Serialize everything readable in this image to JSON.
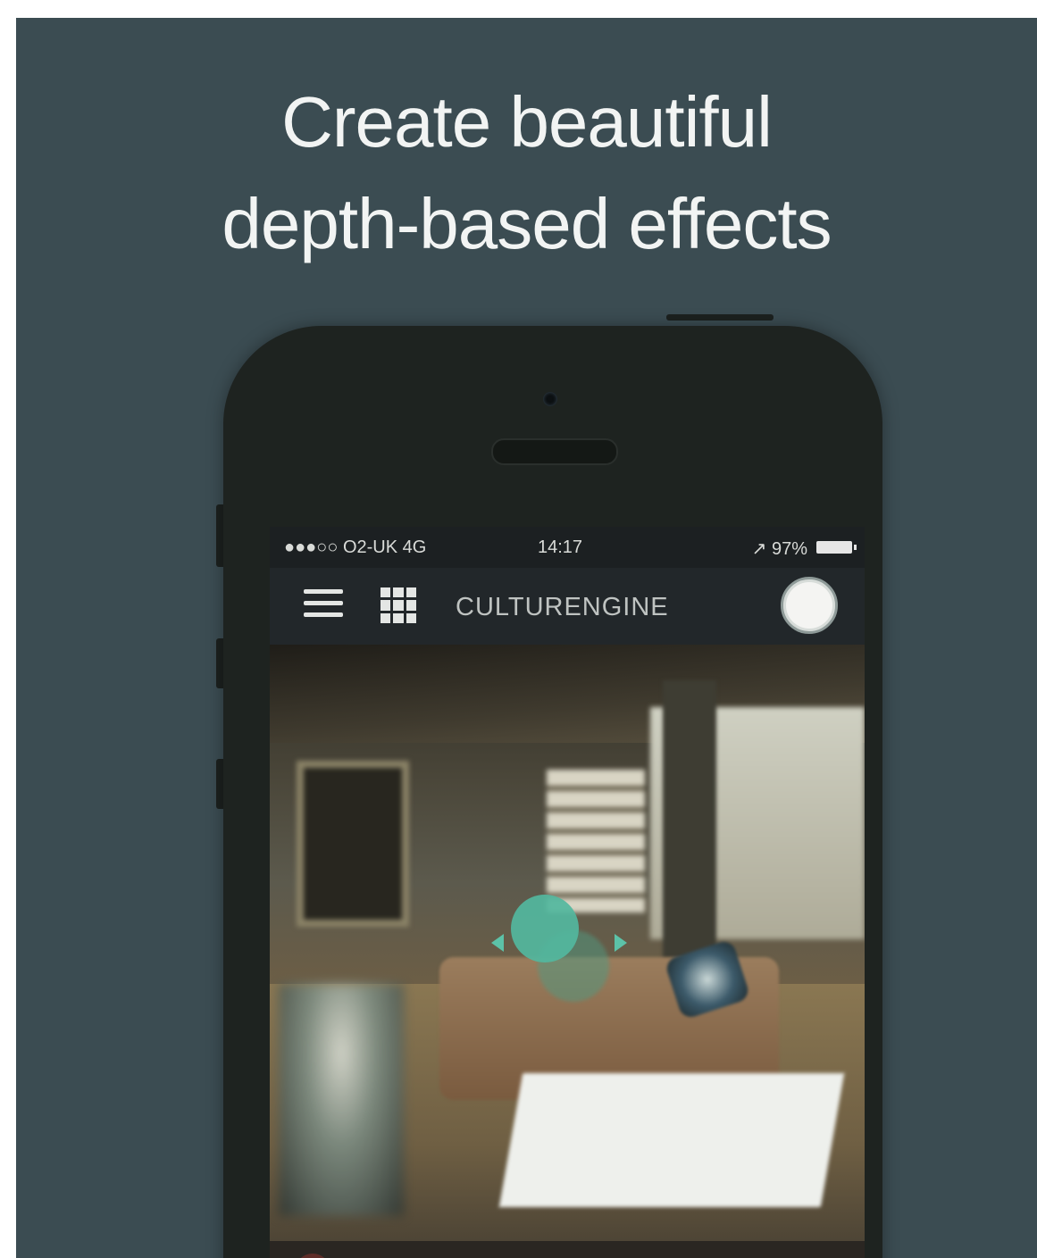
{
  "headline": {
    "line1": "Create beautiful",
    "line2": "depth-based effects"
  },
  "status_bar": {
    "carrier": "●●●○○ O2-UK  4G",
    "time": "14:17",
    "battery": "↗ 97%"
  },
  "nav": {
    "brand": "CULTURENGINE"
  },
  "icons": {
    "menu": "hamburger-icon",
    "grid": "grid-icon",
    "profile": "circle-button-icon",
    "focus": "focus-point-icon"
  },
  "colors": {
    "background": "#3b4c52",
    "phone_body": "#1e2320",
    "focus_accent": "#52b79e"
  }
}
